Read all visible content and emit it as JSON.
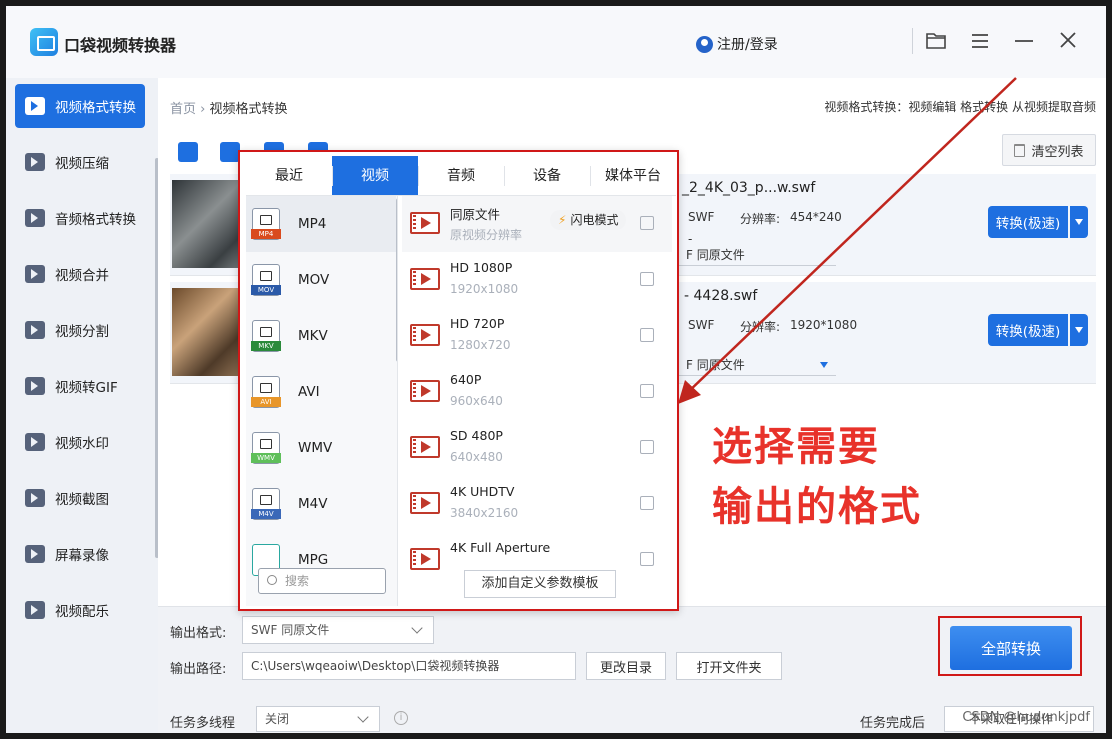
{
  "app": {
    "title": "口袋视频转换器",
    "login": "注册/登录"
  },
  "sidebar": {
    "items": [
      {
        "label": "视频格式转换",
        "icon": "convert-icon",
        "active": true
      },
      {
        "label": "视频压缩",
        "icon": "compress-icon"
      },
      {
        "label": "音频格式转换",
        "icon": "audio-convert-icon"
      },
      {
        "label": "视频合并",
        "icon": "merge-icon"
      },
      {
        "label": "视频分割",
        "icon": "split-icon"
      },
      {
        "label": "视频转GIF",
        "icon": "gif-icon"
      },
      {
        "label": "视频水印",
        "icon": "watermark-icon"
      },
      {
        "label": "视频截图",
        "icon": "screenshot-icon"
      },
      {
        "label": "屏幕录像",
        "icon": "record-icon"
      },
      {
        "label": "视频配乐",
        "icon": "music-icon"
      }
    ]
  },
  "breadcrumb": {
    "home": "首页",
    "sep": "›",
    "current": "视频格式转换",
    "right": "视频格式转换：视频编辑 格式转换 从视频提取音频"
  },
  "clear_list": "清空列表",
  "files": [
    {
      "name": "_2_4K_03_p...w.swf",
      "format": "SWF",
      "res_label": "分辨率:",
      "res": "454*240",
      "dropdown": "F  同原文件",
      "convert": "转换(极速)"
    },
    {
      "name": "- 4428.swf",
      "format": "SWF",
      "res_label": "分辨率:",
      "res": "1920*1080",
      "dropdown": "F  同原文件",
      "convert": "转换(极速)"
    }
  ],
  "file1_dash": "-",
  "panel": {
    "tabs": [
      "最近",
      "视频",
      "音频",
      "设备",
      "媒体平台"
    ],
    "active_tab": 1,
    "formats": [
      {
        "name": "MP4",
        "tag": "MP4",
        "color": "#d94a1e"
      },
      {
        "name": "MOV",
        "tag": "MOV",
        "color": "#2b5aa8"
      },
      {
        "name": "MKV",
        "tag": "MKV",
        "color": "#2a8a3a"
      },
      {
        "name": "AVI",
        "tag": "AVI",
        "color": "#e8962a"
      },
      {
        "name": "WMV",
        "tag": "WMV",
        "color": "#5fbf5a"
      },
      {
        "name": "M4V",
        "tag": "M4V",
        "color": "#3a68b8"
      },
      {
        "name": "MPG",
        "tag": "",
        "color": "#2aa8a0"
      }
    ],
    "qualities": [
      {
        "name": "同原文件",
        "sub": "原视频分辨率"
      },
      {
        "name": "HD 1080P",
        "sub": "1920x1080"
      },
      {
        "name": "HD 720P",
        "sub": "1280x720"
      },
      {
        "name": "640P",
        "sub": "960x640"
      },
      {
        "name": "SD 480P",
        "sub": "640x480"
      },
      {
        "name": "4K UHDTV",
        "sub": "3840x2160"
      },
      {
        "name": "4K Full Aperture",
        "sub": ""
      }
    ],
    "flash_mode": "闪电模式",
    "search_placeholder": "搜索",
    "add_template": "添加自定义参数模板"
  },
  "annotation": {
    "line1": "选择需要",
    "line2": "输出的格式"
  },
  "bottom": {
    "output_format_label": "输出格式:",
    "output_format_value": "SWF  同原文件",
    "output_path_label": "输出路径:",
    "output_path_value": "C:\\Users\\wqeaoiw\\Desktop\\口袋视频转换器",
    "change_dir": "更改目录",
    "open_folder": "打开文件夹",
    "convert_all": "全部转换",
    "multithread_label": "任务多线程",
    "multithread_value": "关闭",
    "after_label": "任务完成后",
    "after_value": "不采取任何操作"
  },
  "watermark": "CSDN @hudunkjpdf",
  "colors": {
    "accent": "#1e6fe0",
    "annotation": "#e8322a",
    "highlight_box": "#d01818"
  }
}
